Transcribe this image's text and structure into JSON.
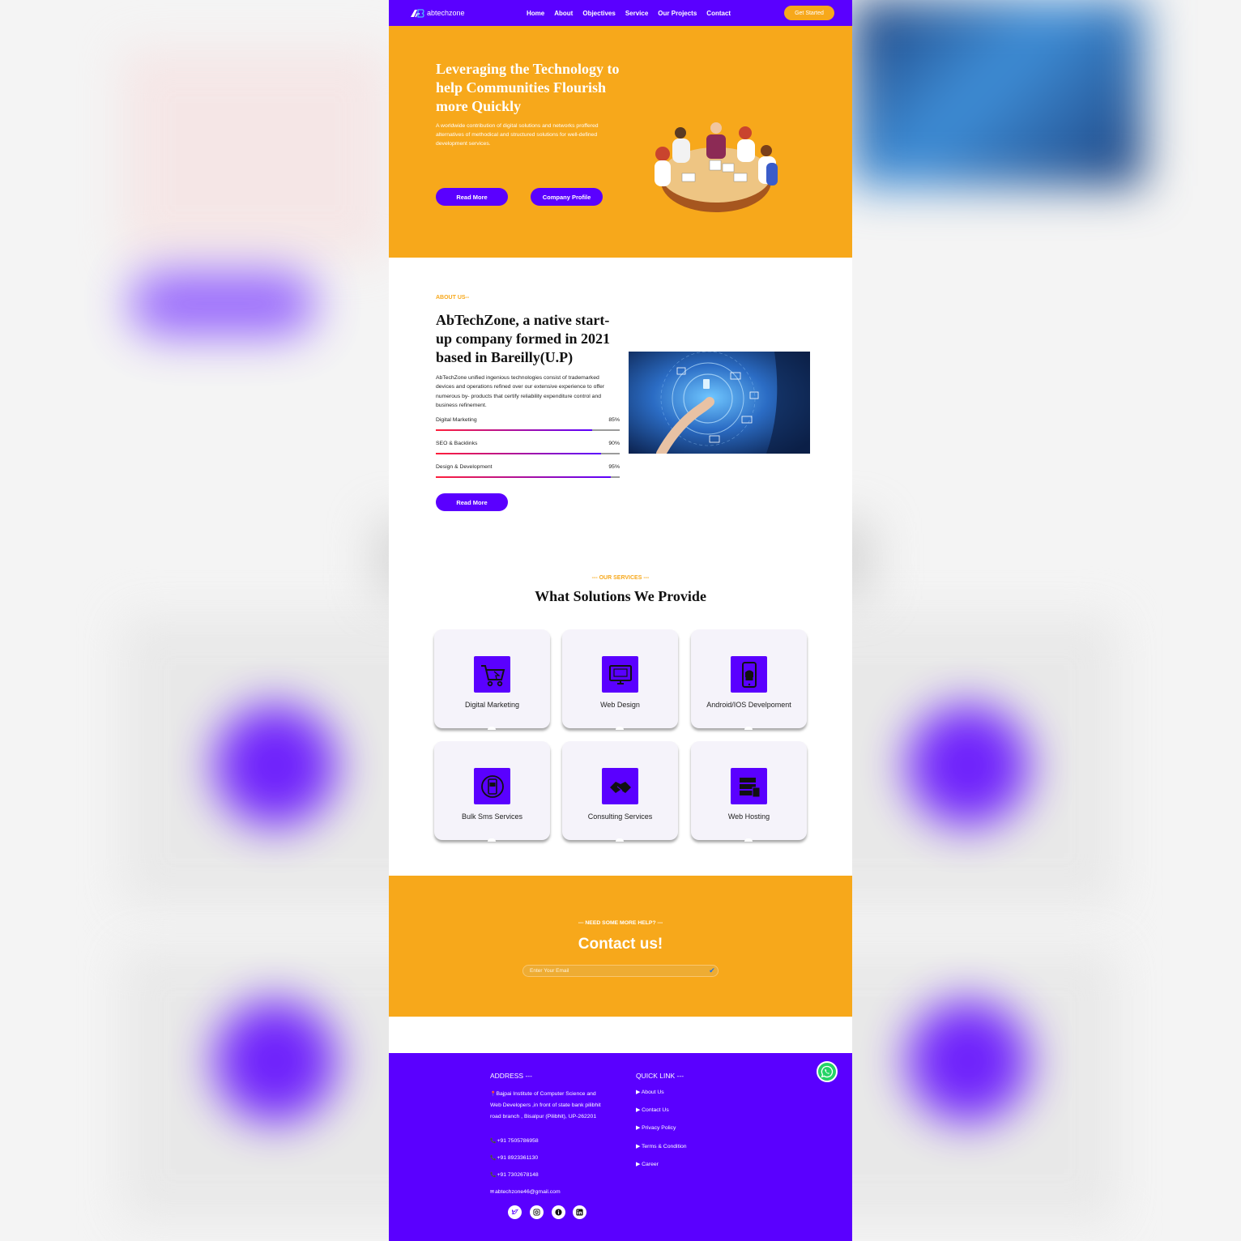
{
  "brand": {
    "name": "abtechzone",
    "accent": "#5a00ff",
    "orange": "#f7a81b"
  },
  "nav": {
    "links": [
      "Home",
      "About",
      "Objectives",
      "Service",
      "Our Projects",
      "Contact"
    ],
    "cta": "Get Started"
  },
  "hero": {
    "title": "Leveraging the Technology to help Communities Flourish more Quickly",
    "text": "A worldwide contribution of digital solutions and networks proffered alternatives of methodical and structured solutions for well-defined development services.",
    "read_more": "Read More",
    "company_profile": "Company Profile",
    "illustration_icon": "team-meeting-illustration"
  },
  "about": {
    "eyebrow": "ABOUT US--",
    "title": "AbTechZone, a native start-up company formed in 2021 based in Bareilly(U.P)",
    "text": "AbTechZone unified ingenious technologies consist of trademarked devices and operations refined over our extensive experience to offer numerous by- products that certify reliability expenditure control and business refinement.",
    "skills": [
      {
        "label": "Digital Marketing",
        "value_label": "85%",
        "percent": 85
      },
      {
        "label": "SEO & Backlinks",
        "value_label": "90%",
        "percent": 90
      },
      {
        "label": "Design & Development",
        "value_label": "95%",
        "percent": 95
      }
    ],
    "read_more": "Read More",
    "image_icon": "digital-network-hand-image"
  },
  "services": {
    "eyebrow": "--- OUR SERVICES ---",
    "title": "What Solutions We Provide",
    "items": [
      {
        "label": "Digital Marketing",
        "icon": "shopping-cart-icon"
      },
      {
        "label": "Web Design",
        "icon": "monitor-icon"
      },
      {
        "label": "Android/IOS Develpoment",
        "icon": "android-phone-icon"
      },
      {
        "label": "Bulk Sms Services",
        "icon": "sms-icon"
      },
      {
        "label": "Consulting Services",
        "icon": "handshake-icon"
      },
      {
        "label": "Web Hosting",
        "icon": "server-icon"
      }
    ]
  },
  "contact": {
    "eyebrow": "--- NEED SOME MORE HELP? ---",
    "title": "Contact us!",
    "email_placeholder": "Enter Your Email",
    "email_value": ""
  },
  "footer": {
    "address_heading": "ADDRESS ---",
    "address": "Bajpai Institute of Computer Science and Web Developers ,in front of state bank pilibhit road branch , Bisalpur (Pilibhit), UP-262201",
    "phones": [
      "+91 7505786958",
      "+91 8923361130",
      "+91 7302678148"
    ],
    "email": "abtechzone46@gmail.com",
    "quick_link_heading": "QUICK LINK ---",
    "quick_links": [
      "About Us",
      "Contact Us",
      "Privacy Policy",
      "Terms & Condition",
      "Career"
    ],
    "socials": [
      "twitter-icon",
      "instagram-icon",
      "info-icon",
      "linkedin-icon"
    ],
    "whatsapp_icon": "whatsapp-icon"
  }
}
